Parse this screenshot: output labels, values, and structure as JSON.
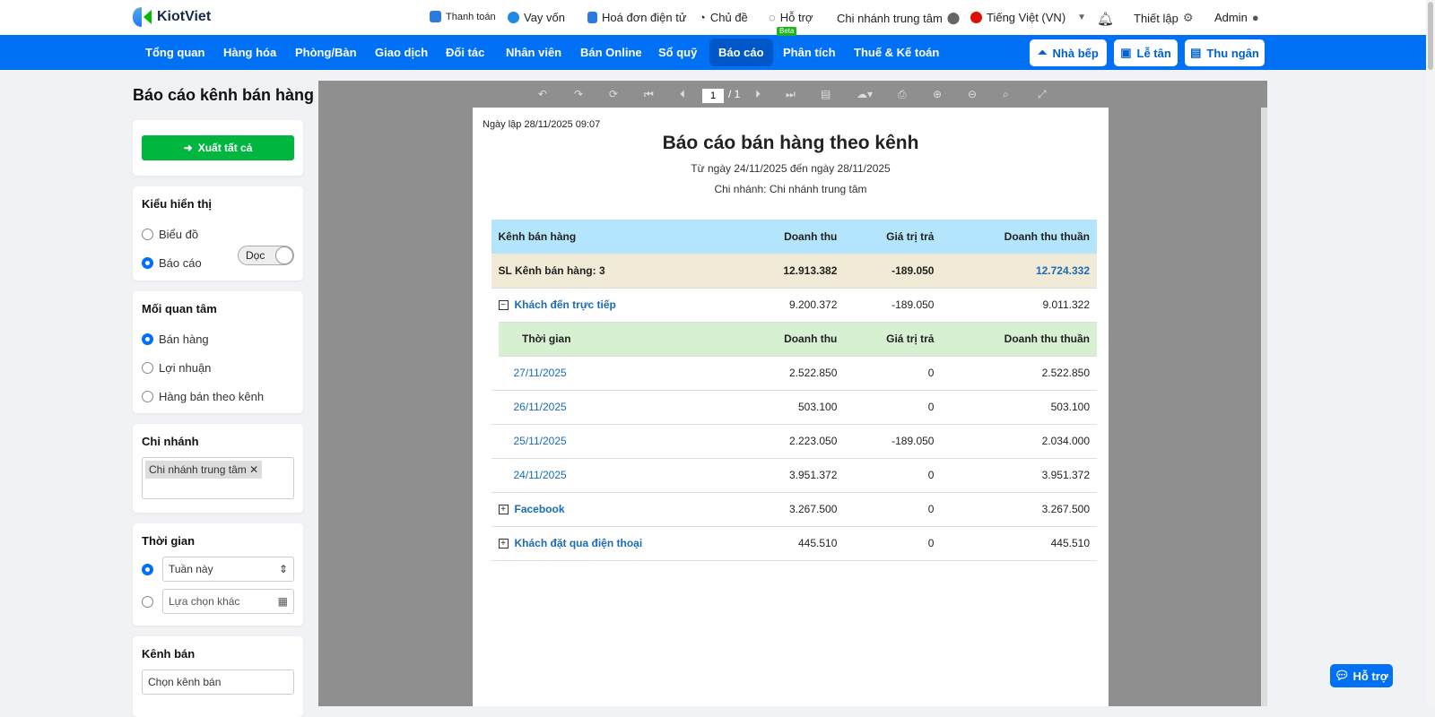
{
  "app": {
    "name": "KiotViet"
  },
  "topbar": {
    "payment": "Thanh toán",
    "loan": "Vay vốn",
    "einvoice": "Hoá đơn điện tử",
    "theme": "Chủ đề",
    "support": "Hỗ trợ",
    "branch": "Chi nhánh trung tâm",
    "language": "Tiếng Việt (VN)",
    "settings": "Thiết lập",
    "user": "Admin"
  },
  "nav": {
    "items": [
      "Tổng quan",
      "Hàng hóa",
      "Phòng/Bàn",
      "Giao dịch",
      "Đối tác",
      "Nhân viên",
      "Bán Online",
      "Sổ quỹ",
      "Báo cáo",
      "Phân tích",
      "Thuế & Kế toán"
    ],
    "active": "Báo cáo",
    "beta_badge": "Beta",
    "kitchen": "Nhà bếp",
    "reception": "Lễ tân",
    "cashier": "Thu ngân"
  },
  "sidebar": {
    "title": "Báo cáo kênh bán hàng",
    "export_all": "Xuất tất cả",
    "display": {
      "label": "Kiểu hiển thị",
      "options": [
        "Biểu đồ",
        "Báo cáo"
      ],
      "selected": "Báo cáo",
      "orientation": "Dọc"
    },
    "concern": {
      "label": "Mối quan tâm",
      "options": [
        "Bán hàng",
        "Lợi nhuận",
        "Hàng bán theo kênh"
      ],
      "selected": "Bán hàng"
    },
    "branch": {
      "label": "Chi nhánh",
      "tag": "Chi nhánh trung tâm"
    },
    "time": {
      "label": "Thời gian",
      "preset": "Tuần này",
      "custom_placeholder": "Lựa chọn khác"
    },
    "channel": {
      "label": "Kênh bán",
      "placeholder": "Chọn kênh bán"
    }
  },
  "viewer": {
    "page": "1",
    "total": "/ 1"
  },
  "report": {
    "created": "Ngày lập 28/11/2025 09:07",
    "title": "Báo cáo bán hàng theo kênh",
    "range": "Từ ngày 24/11/2025 đến ngày 28/11/2025",
    "branch": "Chi nhánh: Chi nhánh trung tâm",
    "headers": [
      "Kênh bán hàng",
      "Doanh thu",
      "Giá trị trả",
      "Doanh thu thuần"
    ],
    "summary": [
      "SL Kênh bán hàng: 3",
      "12.913.382",
      "-189.050",
      "12.724.332"
    ],
    "channels": [
      {
        "name": "Khách đến trực tiếp",
        "values": [
          "9.200.372",
          "-189.050",
          "9.011.322"
        ],
        "expanded": "−"
      },
      {
        "name": "Facebook",
        "values": [
          "3.267.500",
          "0",
          "3.267.500"
        ],
        "expanded": "+"
      },
      {
        "name": "Khách đặt qua điện thoại",
        "values": [
          "445.510",
          "0",
          "445.510"
        ],
        "expanded": "+"
      }
    ],
    "sub_headers": [
      "Thời gian",
      "Doanh thu",
      "Giá trị trả",
      "Doanh thu thuần"
    ],
    "sub_rows": [
      [
        "27/11/2025",
        "2.522.850",
        "0",
        "2.522.850"
      ],
      [
        "26/11/2025",
        "503.100",
        "0",
        "503.100"
      ],
      [
        "25/11/2025",
        "2.223.050",
        "-189.050",
        "2.034.000"
      ],
      [
        "24/11/2025",
        "3.951.372",
        "0",
        "3.951.372"
      ]
    ]
  },
  "help": "Hỗ trợ"
}
